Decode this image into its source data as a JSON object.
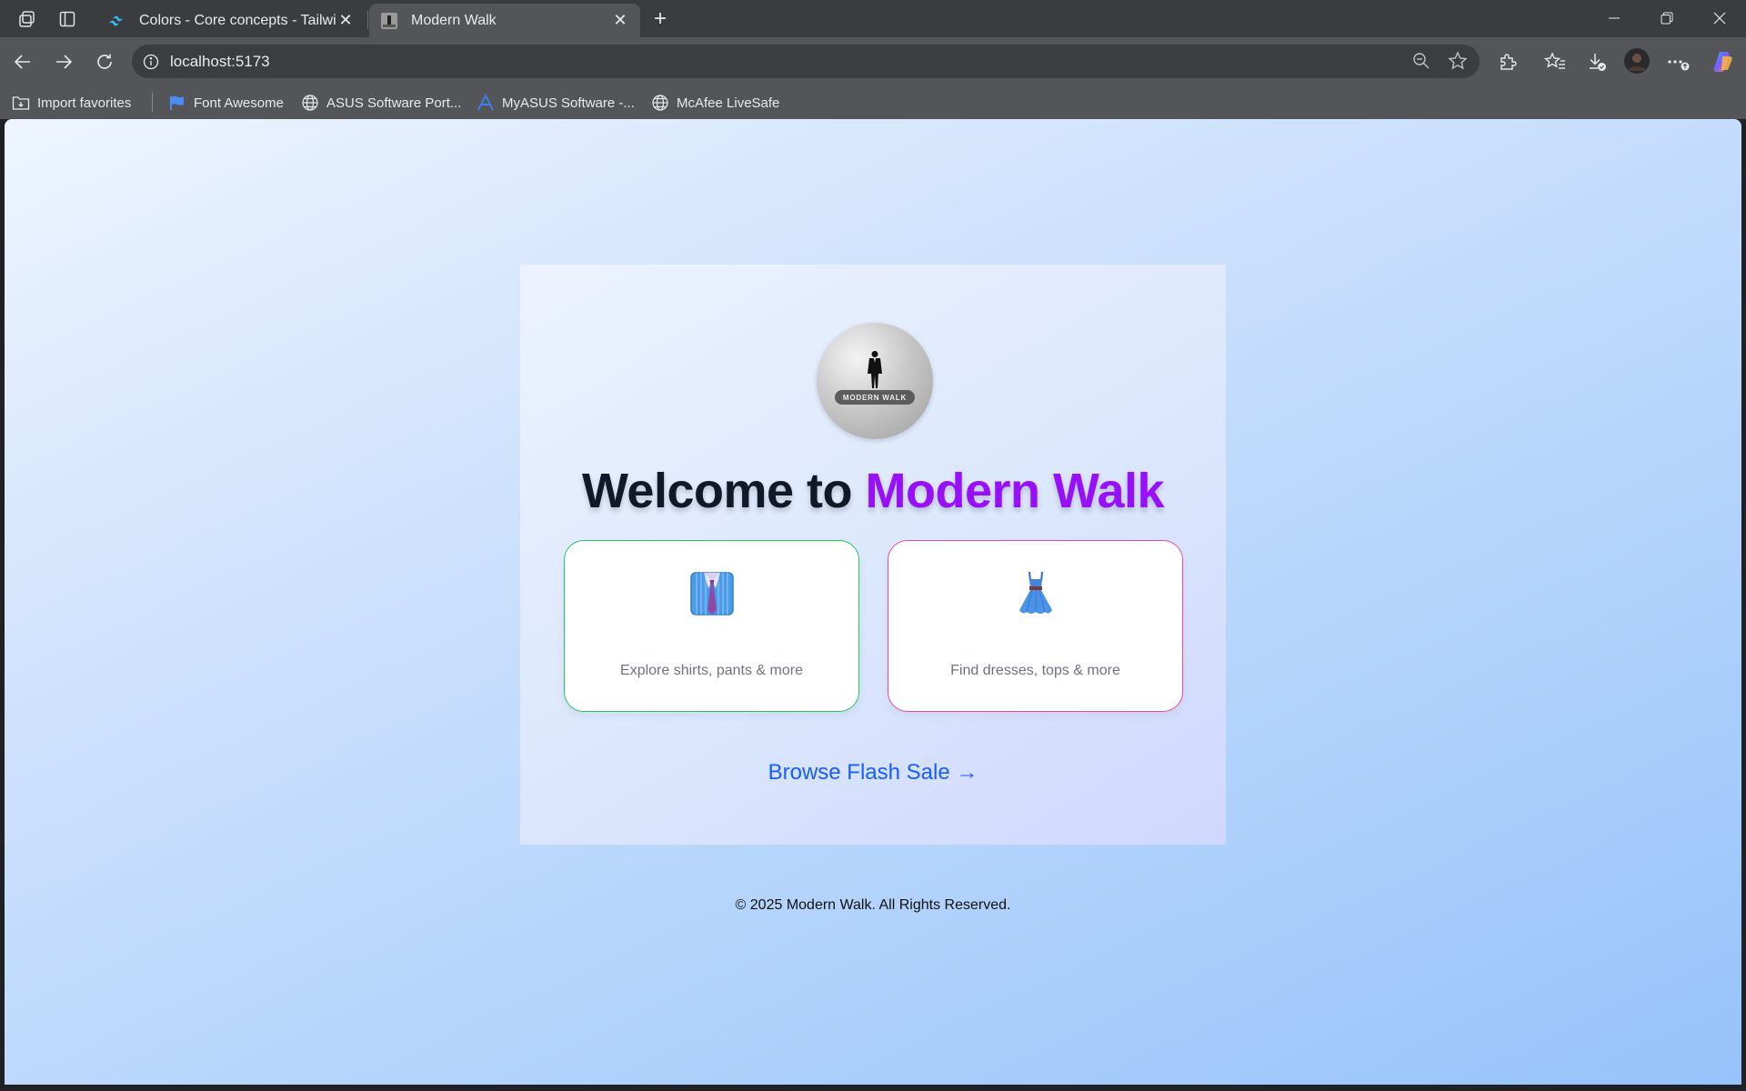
{
  "browser": {
    "tabs": [
      {
        "title": "Colors - Core concepts - Tailwind",
        "active": false,
        "favicon": "tailwind-icon"
      },
      {
        "title": "Modern Walk",
        "active": true,
        "favicon": "modern-walk-icon"
      }
    ],
    "address": {
      "url": "localhost:5173"
    },
    "bookmarks": [
      {
        "label": "Import favorites",
        "icon": "import-icon"
      },
      {
        "label": "Font Awesome",
        "icon": "flag-icon"
      },
      {
        "label": "ASUS Software Port...",
        "icon": "globe-icon"
      },
      {
        "label": "MyASUS Software -...",
        "icon": "asus-icon"
      },
      {
        "label": "McAfee LiveSafe",
        "icon": "globe-icon"
      }
    ]
  },
  "page": {
    "logo_text": "MODERN WALK",
    "heading_part1": "Welcome to ",
    "heading_part2": "Modern Walk",
    "categories": [
      {
        "emoji": "shirt-icon",
        "description": "Explore shirts, pants & more",
        "border_color": "#22c55e"
      },
      {
        "emoji": "dress-icon",
        "description": "Find dresses, tops & more",
        "border_color": "#ec4899"
      }
    ],
    "flash_link": "Browse Flash Sale →",
    "footer": "© 2025 Modern Walk. All Rights Reserved."
  },
  "colors": {
    "heading_dark": "#111827",
    "heading_accent": "#9810fa",
    "link": "#155dfc",
    "muted_text": "#6b7280"
  }
}
